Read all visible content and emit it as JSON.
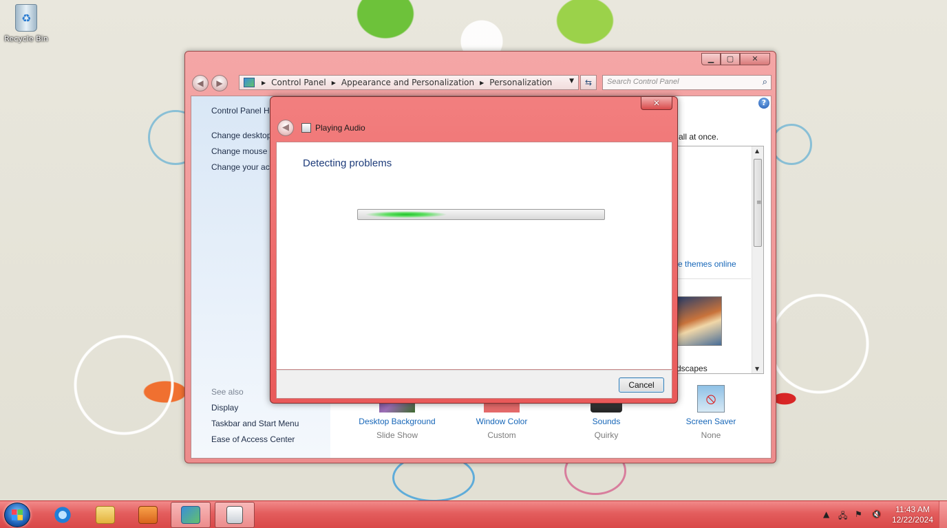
{
  "desktop": {
    "icons": [
      {
        "label": "Recycle Bin"
      }
    ]
  },
  "control_panel": {
    "caption_buttons": {
      "minimize": "▁",
      "maximize": "▢",
      "close": "✕"
    },
    "address": {
      "crumbs": [
        "Control Panel",
        "Appearance and Personalization",
        "Personalization"
      ]
    },
    "search": {
      "placeholder": "Search Control Panel"
    },
    "left_pane": {
      "home": "Control Panel H",
      "tasks": [
        "Change desktop",
        "Change mouse p",
        "Change your ac"
      ],
      "see_also_heading": "See also",
      "see_also": [
        "Display",
        "Taskbar and Start Menu",
        "Ease of Access Center"
      ]
    },
    "main": {
      "intro_tail": "all at once.",
      "themes_online_link": "e themes online",
      "theme_label": "dscapes"
    },
    "bottom_items": [
      {
        "name": "Desktop Background",
        "value": "Slide Show",
        "icon": "desktop-background-icon"
      },
      {
        "name": "Window Color",
        "value": "Custom",
        "icon": "window-color-icon"
      },
      {
        "name": "Sounds",
        "value": "Quirky",
        "icon": "sounds-icon"
      },
      {
        "name": "Screen Saver",
        "value": "None",
        "icon": "screen-saver-icon"
      }
    ]
  },
  "dialog": {
    "title": "Playing Audio",
    "heading": "Detecting problems",
    "progress": 0.35,
    "cancel_label": "Cancel",
    "close_glyph": "✕"
  },
  "taskbar": {
    "clock": {
      "time": "11:43 AM",
      "date": "12/22/2024"
    },
    "pinned": [
      "internet-explorer-icon",
      "windows-explorer-icon",
      "media-player-icon",
      "control-panel-icon",
      "troubleshooter-icon"
    ]
  },
  "colors": {
    "aero_glass": "#ec8c8c",
    "link_blue": "#1666b8",
    "heading_blue": "#1e3c7a",
    "progress_green": "#1fc32a"
  }
}
